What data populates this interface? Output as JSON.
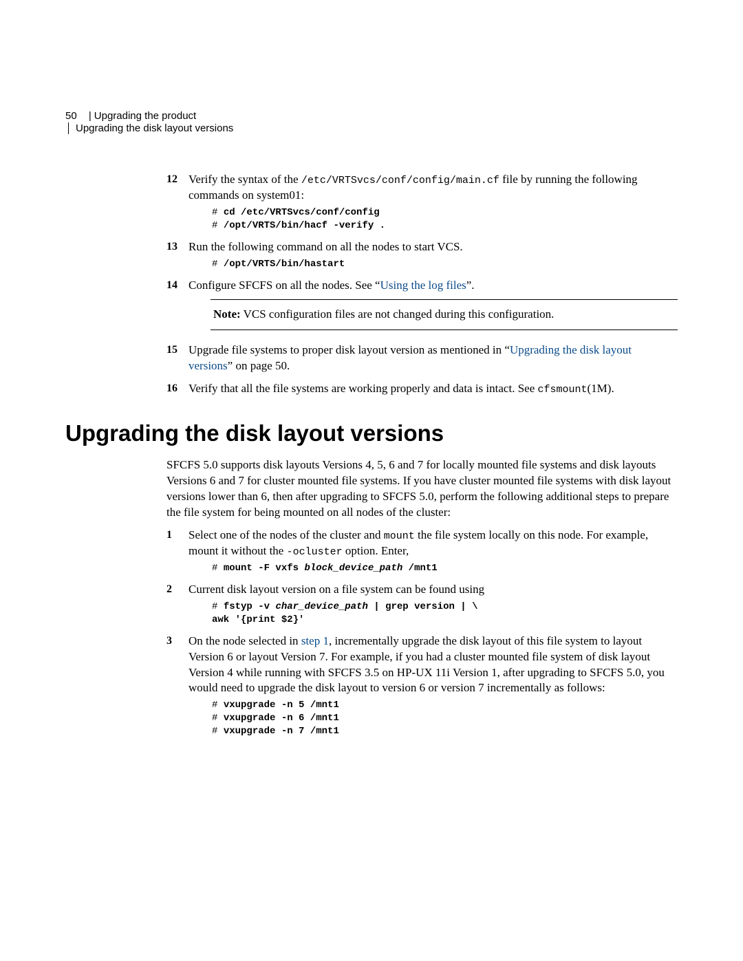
{
  "header": {
    "pageno": "50",
    "line1": "Upgrading the product",
    "line2": "Upgrading the disk layout versions"
  },
  "steps_a": {
    "s12": {
      "num": "12",
      "text_pre": "Verify the syntax of the ",
      "code_inline": "/etc/VRTSvcs/conf/config/main.cf",
      "text_post": " file by running the following commands on system01:",
      "cmd1": {
        "prompt": "# ",
        "cmd": "cd /etc/VRTSvcs/conf/config"
      },
      "cmd2": {
        "prompt": "# ",
        "cmd": "/opt/VRTS/bin/hacf -verify ."
      }
    },
    "s13": {
      "num": "13",
      "text": "Run the following command on all the nodes to start VCS.",
      "cmd1": {
        "prompt": "# ",
        "cmd": "/opt/VRTS/bin/hastart"
      }
    },
    "s14": {
      "num": "14",
      "text_pre": "Configure SFCFS on all the nodes. See “",
      "link": "Using the log files",
      "text_post": "”.",
      "note_label": "Note:",
      "note_text": " VCS configuration files are not changed during this configuration."
    },
    "s15": {
      "num": "15",
      "text_pre": "Upgrade file systems to proper disk layout version as mentioned in “",
      "link": "Upgrading the disk layout versions",
      "text_post": "” on page 50."
    },
    "s16": {
      "num": "16",
      "text_pre": "Verify that all the file systems are working properly and data is intact. See ",
      "code_inline": "cfsmount",
      "text_post": "(1M)."
    }
  },
  "section_title": "Upgrading the disk layout versions",
  "section_intro": "SFCFS 5.0 supports disk layouts Versions 4, 5, 6 and 7 for locally mounted file systems and disk layouts Versions 6 and 7 for cluster mounted file systems. If you have cluster mounted file systems with disk layout versions lower than 6, then after upgrading to SFCFS 5.0, perform the following additional steps to prepare the file system for being mounted on all nodes of the cluster:",
  "steps_b": {
    "s1": {
      "num": "1",
      "text_p1": "Select one of the nodes of the cluster and ",
      "text_c1": "mount",
      "text_p2": " the file system locally on this node. For example, mount it without the ",
      "text_c2": "-ocluster",
      "text_p3": " option. Enter,",
      "cmd1": {
        "prompt": "# ",
        "cmd_a": "mount -F vxfs ",
        "arg": "block_device_path",
        "cmd_b": " /mnt1"
      }
    },
    "s2": {
      "num": "2",
      "text": "Current disk layout version on a file system can be found using",
      "cmd1": {
        "prompt": "# ",
        "cmd_a": "fstyp -v ",
        "arg": "char_device_path",
        "cmd_b": " | grep version | \\"
      },
      "cmd2": {
        "cmd": "awk '{print $2}'"
      }
    },
    "s3": {
      "num": "3",
      "text_pre": "On the node selected in ",
      "link": "step 1",
      "text_post": ", incrementally upgrade the disk layout of this file system to layout Version 6 or layout Version 7. For example, if you had a cluster mounted file system of disk layout Version 4 while running with SFCFS 3.5 on HP-UX 11i Version 1, after upgrading to SFCFS 5.0, you would need to upgrade the disk layout to version 6 or version 7 incrementally as follows:",
      "cmd1": {
        "prompt": "# ",
        "cmd": "vxupgrade -n 5 /mnt1"
      },
      "cmd2": {
        "prompt": "# ",
        "cmd": "vxupgrade -n 6 /mnt1"
      },
      "cmd3": {
        "prompt": "# ",
        "cmd": "vxupgrade -n 7 /mnt1"
      }
    }
  }
}
